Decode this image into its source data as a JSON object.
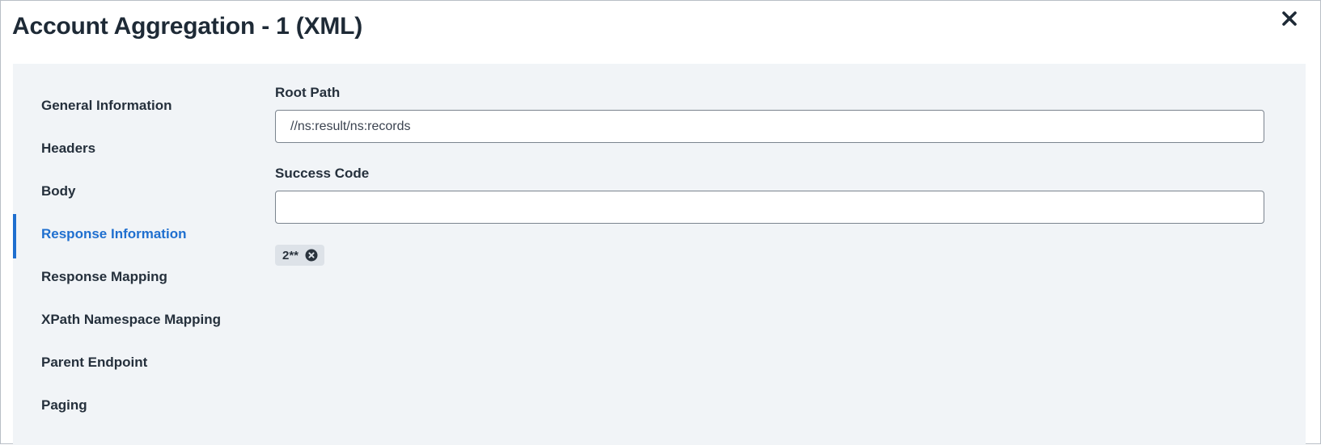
{
  "dialog": {
    "title": "Account Aggregation - 1 (XML)",
    "close_icon": "close-icon"
  },
  "nav": {
    "items": [
      {
        "label": "General Information",
        "active": false
      },
      {
        "label": "Headers",
        "active": false
      },
      {
        "label": "Body",
        "active": false
      },
      {
        "label": "Response Information",
        "active": true
      },
      {
        "label": "Response Mapping",
        "active": false
      },
      {
        "label": "XPath Namespace Mapping",
        "active": false
      },
      {
        "label": "Parent Endpoint",
        "active": false
      },
      {
        "label": "Paging",
        "active": false
      }
    ]
  },
  "form": {
    "root_path": {
      "label": "Root Path",
      "value": "//ns:result/ns:records"
    },
    "success_code": {
      "label": "Success Code",
      "value": "",
      "tags": [
        {
          "text": "2**",
          "remove_icon": "remove-circle-icon"
        }
      ]
    }
  },
  "colors": {
    "accent": "#1f6fcf",
    "panel_background": "#f1f4f7",
    "text": "#25303c",
    "chip_background": "#dde2e8"
  }
}
